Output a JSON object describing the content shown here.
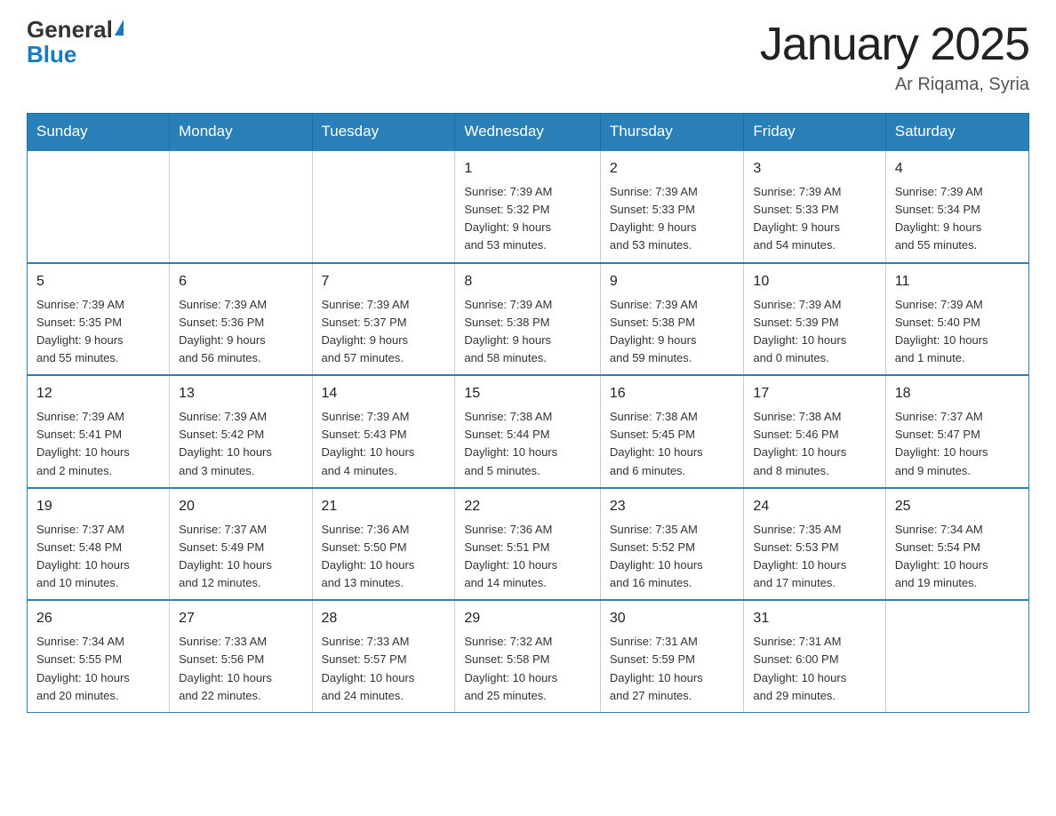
{
  "header": {
    "logo_general": "General",
    "logo_blue": "Blue",
    "month_title": "January 2025",
    "subtitle": "Ar Riqama, Syria"
  },
  "days_of_week": [
    "Sunday",
    "Monday",
    "Tuesday",
    "Wednesday",
    "Thursday",
    "Friday",
    "Saturday"
  ],
  "weeks": [
    [
      {
        "day": "",
        "info": ""
      },
      {
        "day": "",
        "info": ""
      },
      {
        "day": "",
        "info": ""
      },
      {
        "day": "1",
        "info": "Sunrise: 7:39 AM\nSunset: 5:32 PM\nDaylight: 9 hours\nand 53 minutes."
      },
      {
        "day": "2",
        "info": "Sunrise: 7:39 AM\nSunset: 5:33 PM\nDaylight: 9 hours\nand 53 minutes."
      },
      {
        "day": "3",
        "info": "Sunrise: 7:39 AM\nSunset: 5:33 PM\nDaylight: 9 hours\nand 54 minutes."
      },
      {
        "day": "4",
        "info": "Sunrise: 7:39 AM\nSunset: 5:34 PM\nDaylight: 9 hours\nand 55 minutes."
      }
    ],
    [
      {
        "day": "5",
        "info": "Sunrise: 7:39 AM\nSunset: 5:35 PM\nDaylight: 9 hours\nand 55 minutes."
      },
      {
        "day": "6",
        "info": "Sunrise: 7:39 AM\nSunset: 5:36 PM\nDaylight: 9 hours\nand 56 minutes."
      },
      {
        "day": "7",
        "info": "Sunrise: 7:39 AM\nSunset: 5:37 PM\nDaylight: 9 hours\nand 57 minutes."
      },
      {
        "day": "8",
        "info": "Sunrise: 7:39 AM\nSunset: 5:38 PM\nDaylight: 9 hours\nand 58 minutes."
      },
      {
        "day": "9",
        "info": "Sunrise: 7:39 AM\nSunset: 5:38 PM\nDaylight: 9 hours\nand 59 minutes."
      },
      {
        "day": "10",
        "info": "Sunrise: 7:39 AM\nSunset: 5:39 PM\nDaylight: 10 hours\nand 0 minutes."
      },
      {
        "day": "11",
        "info": "Sunrise: 7:39 AM\nSunset: 5:40 PM\nDaylight: 10 hours\nand 1 minute."
      }
    ],
    [
      {
        "day": "12",
        "info": "Sunrise: 7:39 AM\nSunset: 5:41 PM\nDaylight: 10 hours\nand 2 minutes."
      },
      {
        "day": "13",
        "info": "Sunrise: 7:39 AM\nSunset: 5:42 PM\nDaylight: 10 hours\nand 3 minutes."
      },
      {
        "day": "14",
        "info": "Sunrise: 7:39 AM\nSunset: 5:43 PM\nDaylight: 10 hours\nand 4 minutes."
      },
      {
        "day": "15",
        "info": "Sunrise: 7:38 AM\nSunset: 5:44 PM\nDaylight: 10 hours\nand 5 minutes."
      },
      {
        "day": "16",
        "info": "Sunrise: 7:38 AM\nSunset: 5:45 PM\nDaylight: 10 hours\nand 6 minutes."
      },
      {
        "day": "17",
        "info": "Sunrise: 7:38 AM\nSunset: 5:46 PM\nDaylight: 10 hours\nand 8 minutes."
      },
      {
        "day": "18",
        "info": "Sunrise: 7:37 AM\nSunset: 5:47 PM\nDaylight: 10 hours\nand 9 minutes."
      }
    ],
    [
      {
        "day": "19",
        "info": "Sunrise: 7:37 AM\nSunset: 5:48 PM\nDaylight: 10 hours\nand 10 minutes."
      },
      {
        "day": "20",
        "info": "Sunrise: 7:37 AM\nSunset: 5:49 PM\nDaylight: 10 hours\nand 12 minutes."
      },
      {
        "day": "21",
        "info": "Sunrise: 7:36 AM\nSunset: 5:50 PM\nDaylight: 10 hours\nand 13 minutes."
      },
      {
        "day": "22",
        "info": "Sunrise: 7:36 AM\nSunset: 5:51 PM\nDaylight: 10 hours\nand 14 minutes."
      },
      {
        "day": "23",
        "info": "Sunrise: 7:35 AM\nSunset: 5:52 PM\nDaylight: 10 hours\nand 16 minutes."
      },
      {
        "day": "24",
        "info": "Sunrise: 7:35 AM\nSunset: 5:53 PM\nDaylight: 10 hours\nand 17 minutes."
      },
      {
        "day": "25",
        "info": "Sunrise: 7:34 AM\nSunset: 5:54 PM\nDaylight: 10 hours\nand 19 minutes."
      }
    ],
    [
      {
        "day": "26",
        "info": "Sunrise: 7:34 AM\nSunset: 5:55 PM\nDaylight: 10 hours\nand 20 minutes."
      },
      {
        "day": "27",
        "info": "Sunrise: 7:33 AM\nSunset: 5:56 PM\nDaylight: 10 hours\nand 22 minutes."
      },
      {
        "day": "28",
        "info": "Sunrise: 7:33 AM\nSunset: 5:57 PM\nDaylight: 10 hours\nand 24 minutes."
      },
      {
        "day": "29",
        "info": "Sunrise: 7:32 AM\nSunset: 5:58 PM\nDaylight: 10 hours\nand 25 minutes."
      },
      {
        "day": "30",
        "info": "Sunrise: 7:31 AM\nSunset: 5:59 PM\nDaylight: 10 hours\nand 27 minutes."
      },
      {
        "day": "31",
        "info": "Sunrise: 7:31 AM\nSunset: 6:00 PM\nDaylight: 10 hours\nand 29 minutes."
      },
      {
        "day": "",
        "info": ""
      }
    ]
  ]
}
